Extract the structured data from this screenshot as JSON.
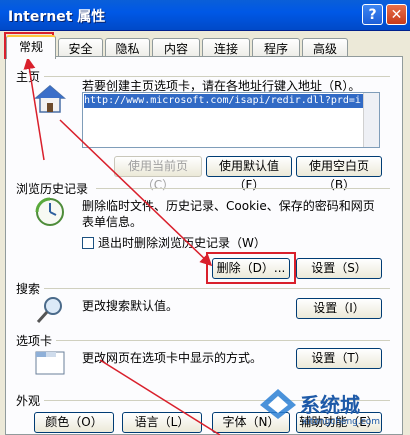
{
  "window": {
    "title": "Internet 属性",
    "help": "?",
    "close": "✕"
  },
  "tabs": [
    "常规",
    "安全",
    "隐私",
    "内容",
    "连接",
    "程序",
    "高级"
  ],
  "homepage": {
    "section": "主页",
    "desc": "若要创建主页选项卡，请在各地址行键入地址（R）。",
    "url": "http://www.microsoft.com/isapi/redir.dll?prd=i",
    "btn_current": "使用当前页（C）",
    "btn_default": "使用默认值（F）",
    "btn_blank": "使用空白页（B）"
  },
  "history": {
    "section": "浏览历史记录",
    "desc1": "删除临时文件、历史记录、Cookie、保存的密码和网页",
    "desc2": "表单信息。",
    "checkbox": "退出时删除浏览历史记录（W）",
    "btn_delete": "删除（D）...",
    "btn_settings": "设置（S）"
  },
  "search": {
    "section": "搜索",
    "desc": "更改搜索默认值。",
    "btn_settings": "设置（I）"
  },
  "tabsection": {
    "section": "选项卡",
    "desc": "更改网页在选项卡中显示的方式。",
    "btn_settings": "设置（T）"
  },
  "appearance": {
    "section": "外观",
    "btn_colors": "颜色（O）",
    "btn_languages": "语言（L）",
    "btn_fonts": "字体（N）",
    "btn_access": "辅助功能（E）"
  },
  "watermark": {
    "text": "系统城",
    "sub": "xitongcheng.com"
  },
  "colors": {
    "titlebar": "#0058e6",
    "annotation": "#d9202c"
  }
}
